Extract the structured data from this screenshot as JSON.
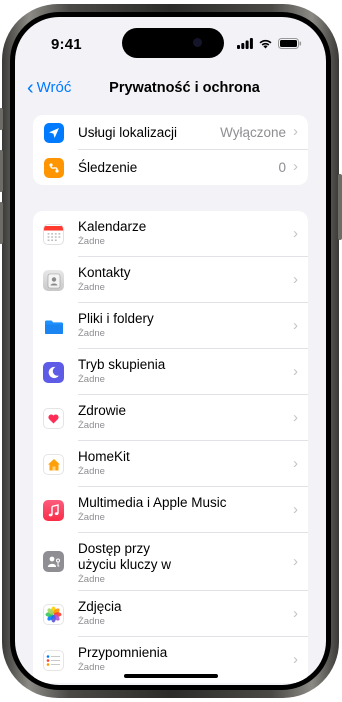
{
  "status_bar": {
    "time": "9:41"
  },
  "nav": {
    "back_label": "Wróć",
    "title": "Prywatność i ochrona"
  },
  "top_section": [
    {
      "label": "Usługi lokalizacji",
      "value": "Wyłączone",
      "icon": "location-arrow-icon",
      "color": "#007aff"
    },
    {
      "label": "Śledzenie",
      "value": "0",
      "icon": "tracking-icon",
      "color": "#ff9500"
    }
  ],
  "apps_section": [
    {
      "title": "Kalendarze",
      "subtitle": "Żadne",
      "icon": "calendar-icon"
    },
    {
      "title": "Kontakty",
      "subtitle": "Żadne",
      "icon": "contacts-icon"
    },
    {
      "title": "Pliki i foldery",
      "subtitle": "Żadne",
      "icon": "folder-icon"
    },
    {
      "title": "Tryb skupienia",
      "subtitle": "Żadne",
      "icon": "moon-icon"
    },
    {
      "title": "Zdrowie",
      "subtitle": "Żadne",
      "icon": "heart-icon"
    },
    {
      "title": "HomeKit",
      "subtitle": "Żadne",
      "icon": "home-icon"
    },
    {
      "title": "Multimedia i Apple Music",
      "subtitle": "Żadne",
      "icon": "music-note-icon"
    },
    {
      "title": "Dostęp przy",
      "title_line2": "użyciu kluczy w",
      "subtitle": "Żadne",
      "icon": "passkey-icon"
    },
    {
      "title": "Zdjęcia",
      "subtitle": "Żadne",
      "icon": "photos-icon"
    },
    {
      "title": "Przypomnienia",
      "subtitle": "Żadne",
      "icon": "reminders-icon"
    }
  ],
  "colors": {
    "accent": "#007aff",
    "background": "#f2f2f7",
    "focus": "#5e5ce6",
    "music": "#fa2d48",
    "home": "#ff9f0a"
  }
}
